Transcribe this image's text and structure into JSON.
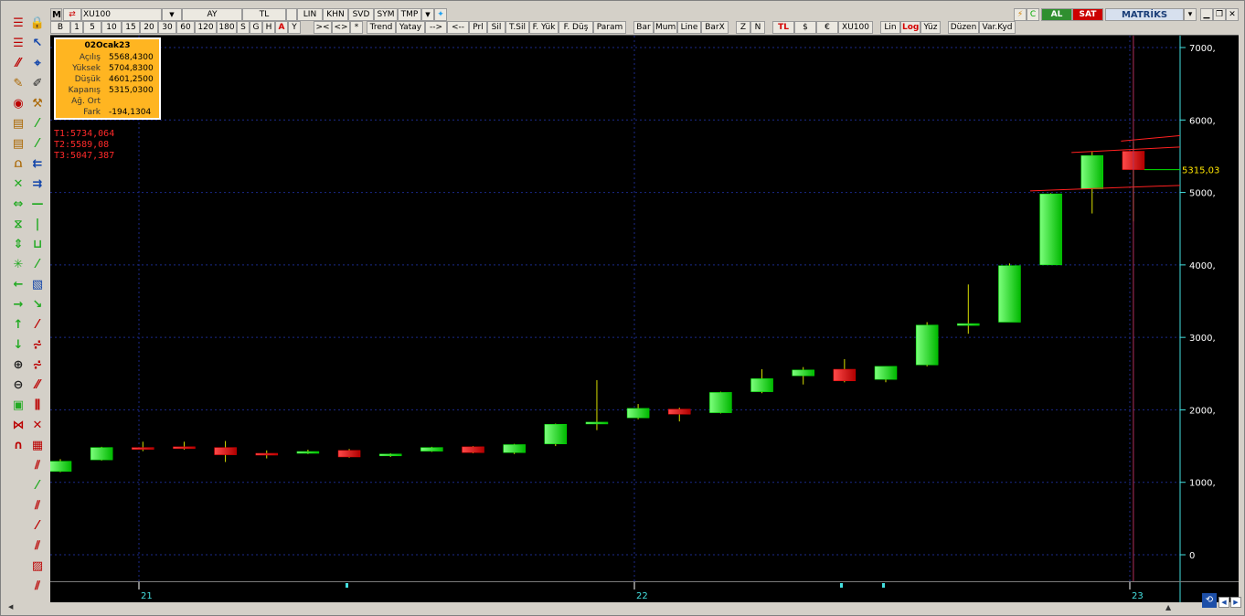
{
  "toolbar_top": {
    "m_label": "M",
    "symbol": "XU100",
    "period": "AY",
    "currency": "TL",
    "scale": "LIN",
    "khn": "KHN",
    "svd": "SVD",
    "sym": "SYM",
    "tmp": "TMP",
    "al": "AL",
    "sat": "SAT",
    "brand": "MATRİKS"
  },
  "toolbar_second": {
    "b": "B",
    "intervals": [
      "1",
      "5",
      "10",
      "15",
      "20",
      "30",
      "60",
      "120",
      "180",
      "S",
      "G",
      "H",
      "A",
      "Y"
    ],
    "nav_items": [
      "><",
      "<>",
      "*"
    ],
    "tools": [
      "Trend",
      "Yatay",
      "-->",
      "<--",
      "Prl",
      "Sil",
      "T.Sil",
      "F. Yük",
      "F. Düş",
      "Param"
    ],
    "chart_types": [
      "Bar",
      "Mum",
      "Line",
      "BarX"
    ],
    "zn": [
      "Z",
      "N"
    ],
    "currencies": [
      "TL",
      "$",
      "€"
    ],
    "index_symbol": "XU100",
    "scales": [
      "Lin",
      "Log",
      "Yüz"
    ],
    "edit": [
      "Düzen",
      "Var.Kyd"
    ]
  },
  "info_box": {
    "date": "02Ocak23",
    "rows": [
      {
        "label": "Açılış",
        "value": "5568,4300"
      },
      {
        "label": "Yüksek",
        "value": "5704,8300"
      },
      {
        "label": "Düşük",
        "value": "4601,2500"
      },
      {
        "label": "Kapanış",
        "value": "5315,0300"
      },
      {
        "label": "Ağ. Ort",
        "value": ""
      },
      {
        "label": "Fark",
        "value": "-194,1304"
      }
    ]
  },
  "trend_levels": [
    "T1:5734,064",
    "T2:5589,08",
    "T3:5047,387"
  ],
  "chart_data": {
    "type": "candlestick",
    "x_labels": [
      "21",
      "22",
      "23"
    ],
    "ylim": [
      -300,
      7200
    ],
    "y_ticks": [
      7000,
      6000,
      5000,
      4000,
      3000,
      2000,
      1000,
      0
    ],
    "y_tick_labels": [
      "7000,",
      "6000,",
      "5000,",
      "4000,",
      "3000,",
      "2000,",
      "1000,",
      "0"
    ],
    "last_price_label": "5315,03",
    "last_price": 5315.03,
    "trend_lines": [
      5734.064,
      5589.08,
      5047.387
    ],
    "candles": [
      {
        "o": 1150,
        "h": 1320,
        "l": 1140,
        "c": 1290
      },
      {
        "o": 1310,
        "h": 1490,
        "l": 1300,
        "c": 1480
      },
      {
        "o": 1480,
        "h": 1560,
        "l": 1430,
        "c": 1470
      },
      {
        "o": 1490,
        "h": 1560,
        "l": 1450,
        "c": 1470
      },
      {
        "o": 1480,
        "h": 1570,
        "l": 1280,
        "c": 1380
      },
      {
        "o": 1400,
        "h": 1440,
        "l": 1330,
        "c": 1390
      },
      {
        "o": 1410,
        "h": 1450,
        "l": 1390,
        "c": 1425
      },
      {
        "o": 1440,
        "h": 1460,
        "l": 1340,
        "c": 1350
      },
      {
        "o": 1370,
        "h": 1400,
        "l": 1350,
        "c": 1390
      },
      {
        "o": 1430,
        "h": 1490,
        "l": 1420,
        "c": 1480
      },
      {
        "o": 1490,
        "h": 1500,
        "l": 1400,
        "c": 1410
      },
      {
        "o": 1410,
        "h": 1530,
        "l": 1390,
        "c": 1520
      },
      {
        "o": 1530,
        "h": 1810,
        "l": 1500,
        "c": 1800
      },
      {
        "o": 1810,
        "h": 2410,
        "l": 1720,
        "c": 1830
      },
      {
        "o": 1890,
        "h": 2080,
        "l": 1870,
        "c": 2020
      },
      {
        "o": 2010,
        "h": 2030,
        "l": 1840,
        "c": 1940
      },
      {
        "o": 1960,
        "h": 2250,
        "l": 1950,
        "c": 2240
      },
      {
        "o": 2250,
        "h": 2560,
        "l": 2230,
        "c": 2430
      },
      {
        "o": 2470,
        "h": 2590,
        "l": 2350,
        "c": 2550
      },
      {
        "o": 2560,
        "h": 2700,
        "l": 2380,
        "c": 2400
      },
      {
        "o": 2420,
        "h": 2600,
        "l": 2380,
        "c": 2600
      },
      {
        "o": 2620,
        "h": 3210,
        "l": 2600,
        "c": 3170
      },
      {
        "o": 3170,
        "h": 3730,
        "l": 3050,
        "c": 3190
      },
      {
        "o": 3210,
        "h": 4020,
        "l": 3210,
        "c": 3990
      },
      {
        "o": 4000,
        "h": 4990,
        "l": 4000,
        "c": 4980
      },
      {
        "o": 5050,
        "h": 5560,
        "l": 4710,
        "c": 5510
      },
      {
        "o": 5568.43,
        "h": 5704.83,
        "l": 4601.25,
        "c": 5315.03
      }
    ]
  },
  "colors": {
    "up": "#00e600",
    "down": "#e00000",
    "axis_text": "#44e0e0",
    "grid": "#1b2a8a",
    "trend": "#ff2020",
    "last_price": "#ffe600",
    "info_bg": "#ffb521"
  }
}
